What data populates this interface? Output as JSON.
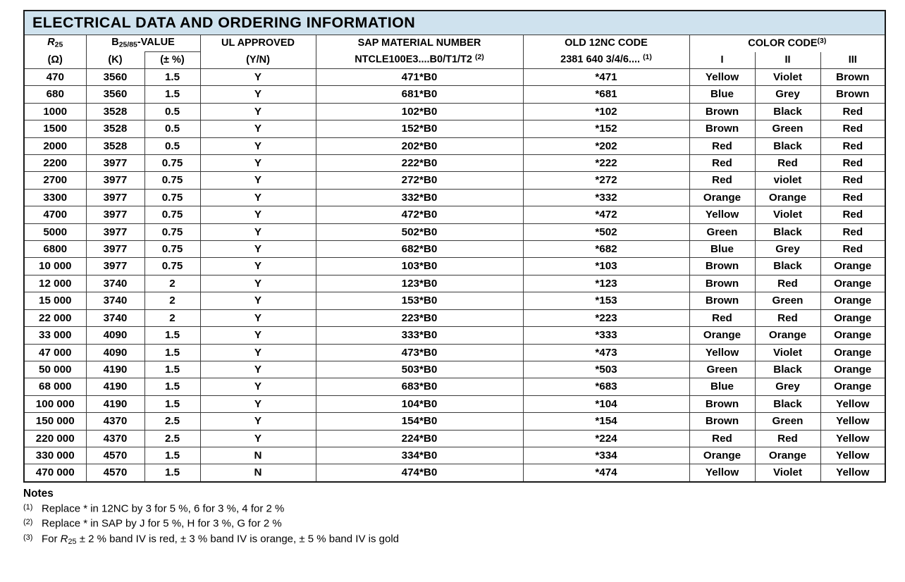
{
  "table": {
    "title": "ELECTRICAL DATA AND ORDERING INFORMATION",
    "title_background": "#cfe2ee",
    "headers": {
      "r25_label": "R",
      "r25_sub": "25",
      "r25_unit": "(Ω)",
      "bvalue_label": "B",
      "bvalue_sub": "25/85",
      "bvalue_suffix": "-VALUE",
      "bvalue_unit": "(K)",
      "btol_unit": "(± %)",
      "ul_approved": "UL APPROVED",
      "ul_approved_unit": "(Y/N)",
      "sap_material_number": "SAP MATERIAL NUMBER",
      "sap_material_format": "NTCLE100E3....B0/T1/T2",
      "sap_material_note": "(2)",
      "old_12nc_code": "OLD 12NC CODE",
      "old_12nc_format": "2381 640 3/4/6....",
      "old_12nc_note": "(1)",
      "color_code": "COLOR CODE",
      "color_code_note": "(3)",
      "band_1": "I",
      "band_2": "II",
      "band_3": "III"
    },
    "columns": [
      "R25",
      "B25/85-VALUE (K)",
      "B25/85-VALUE (± %)",
      "UL APPROVED",
      "SAP MATERIAL NUMBER",
      "OLD 12NC CODE",
      "COLOR CODE I",
      "COLOR CODE II",
      "COLOR CODE III"
    ],
    "rows": [
      {
        "r25": "470",
        "bvalue": "3560",
        "btol": "1.5",
        "ul": "Y",
        "sap": "471*B0",
        "code12nc": "*471",
        "band1": "Yellow",
        "band2": "Violet",
        "band3": "Brown"
      },
      {
        "r25": "680",
        "bvalue": "3560",
        "btol": "1.5",
        "ul": "Y",
        "sap": "681*B0",
        "code12nc": "*681",
        "band1": "Blue",
        "band2": "Grey",
        "band3": "Brown"
      },
      {
        "r25": "1000",
        "bvalue": "3528",
        "btol": "0.5",
        "ul": "Y",
        "sap": "102*B0",
        "code12nc": "*102",
        "band1": "Brown",
        "band2": "Black",
        "band3": "Red"
      },
      {
        "r25": "1500",
        "bvalue": "3528",
        "btol": "0.5",
        "ul": "Y",
        "sap": "152*B0",
        "code12nc": "*152",
        "band1": "Brown",
        "band2": "Green",
        "band3": "Red"
      },
      {
        "r25": "2000",
        "bvalue": "3528",
        "btol": "0.5",
        "ul": "Y",
        "sap": "202*B0",
        "code12nc": "*202",
        "band1": "Red",
        "band2": "Black",
        "band3": "Red"
      },
      {
        "r25": "2200",
        "bvalue": "3977",
        "btol": "0.75",
        "ul": "Y",
        "sap": "222*B0",
        "code12nc": "*222",
        "band1": "Red",
        "band2": "Red",
        "band3": "Red"
      },
      {
        "r25": "2700",
        "bvalue": "3977",
        "btol": "0.75",
        "ul": "Y",
        "sap": "272*B0",
        "code12nc": "*272",
        "band1": "Red",
        "band2": "violet",
        "band3": "Red"
      },
      {
        "r25": "3300",
        "bvalue": "3977",
        "btol": "0.75",
        "ul": "Y",
        "sap": "332*B0",
        "code12nc": "*332",
        "band1": "Orange",
        "band2": "Orange",
        "band3": "Red"
      },
      {
        "r25": "4700",
        "bvalue": "3977",
        "btol": "0.75",
        "ul": "Y",
        "sap": "472*B0",
        "code12nc": "*472",
        "band1": "Yellow",
        "band2": "Violet",
        "band3": "Red"
      },
      {
        "r25": "5000",
        "bvalue": "3977",
        "btol": "0.75",
        "ul": "Y",
        "sap": "502*B0",
        "code12nc": "*502",
        "band1": "Green",
        "band2": "Black",
        "band3": "Red"
      },
      {
        "r25": "6800",
        "bvalue": "3977",
        "btol": "0.75",
        "ul": "Y",
        "sap": "682*B0",
        "code12nc": "*682",
        "band1": "Blue",
        "band2": "Grey",
        "band3": "Red"
      },
      {
        "r25": "10 000",
        "bvalue": "3977",
        "btol": "0.75",
        "ul": "Y",
        "sap": "103*B0",
        "code12nc": "*103",
        "band1": "Brown",
        "band2": "Black",
        "band3": "Orange"
      },
      {
        "r25": "12 000",
        "bvalue": "3740",
        "btol": "2",
        "ul": "Y",
        "sap": "123*B0",
        "code12nc": "*123",
        "band1": "Brown",
        "band2": "Red",
        "band3": "Orange"
      },
      {
        "r25": "15 000",
        "bvalue": "3740",
        "btol": "2",
        "ul": "Y",
        "sap": "153*B0",
        "code12nc": "*153",
        "band1": "Brown",
        "band2": "Green",
        "band3": "Orange"
      },
      {
        "r25": "22 000",
        "bvalue": "3740",
        "btol": "2",
        "ul": "Y",
        "sap": "223*B0",
        "code12nc": "*223",
        "band1": "Red",
        "band2": "Red",
        "band3": "Orange"
      },
      {
        "r25": "33 000",
        "bvalue": "4090",
        "btol": "1.5",
        "ul": "Y",
        "sap": "333*B0",
        "code12nc": "*333",
        "band1": "Orange",
        "band2": "Orange",
        "band3": "Orange"
      },
      {
        "r25": "47 000",
        "bvalue": "4090",
        "btol": "1.5",
        "ul": "Y",
        "sap": "473*B0",
        "code12nc": "*473",
        "band1": "Yellow",
        "band2": "Violet",
        "band3": "Orange"
      },
      {
        "r25": "50 000",
        "bvalue": "4190",
        "btol": "1.5",
        "ul": "Y",
        "sap": "503*B0",
        "code12nc": "*503",
        "band1": "Green",
        "band2": "Black",
        "band3": "Orange"
      },
      {
        "r25": "68 000",
        "bvalue": "4190",
        "btol": "1.5",
        "ul": "Y",
        "sap": "683*B0",
        "code12nc": "*683",
        "band1": "Blue",
        "band2": "Grey",
        "band3": "Orange"
      },
      {
        "r25": "100 000",
        "bvalue": "4190",
        "btol": "1.5",
        "ul": "Y",
        "sap": "104*B0",
        "code12nc": "*104",
        "band1": "Brown",
        "band2": "Black",
        "band3": "Yellow"
      },
      {
        "r25": "150 000",
        "bvalue": "4370",
        "btol": "2.5",
        "ul": "Y",
        "sap": "154*B0",
        "code12nc": "*154",
        "band1": "Brown",
        "band2": "Green",
        "band3": "Yellow"
      },
      {
        "r25": "220 000",
        "bvalue": "4370",
        "btol": "2.5",
        "ul": "Y",
        "sap": "224*B0",
        "code12nc": "*224",
        "band1": "Red",
        "band2": "Red",
        "band3": "Yellow"
      },
      {
        "r25": "330 000",
        "bvalue": "4570",
        "btol": "1.5",
        "ul": "N",
        "sap": "334*B0",
        "code12nc": "*334",
        "band1": "Orange",
        "band2": "Orange",
        "band3": "Yellow"
      },
      {
        "r25": "470 000",
        "bvalue": "4570",
        "btol": "1.5",
        "ul": "N",
        "sap": "474*B0",
        "code12nc": "*474",
        "band1": "Yellow",
        "band2": "Violet",
        "band3": "Yellow"
      }
    ]
  },
  "notes": {
    "title": "Notes",
    "items": [
      {
        "marker": "(1)",
        "text": "Replace * in 12NC by 3 for 5 %, 6 for 3 %, 4 for 2 %"
      },
      {
        "marker": "(2)",
        "text": "Replace * in SAP by J for 5 %, H for 3 %, G for 2 %"
      },
      {
        "marker": "(3)",
        "text_before": "For ",
        "r_label": "R",
        "r_sub": "25",
        "text_after": " ± 2 % band IV is red, ± 3 % band IV is orange, ± 5 % band IV is gold"
      }
    ]
  }
}
